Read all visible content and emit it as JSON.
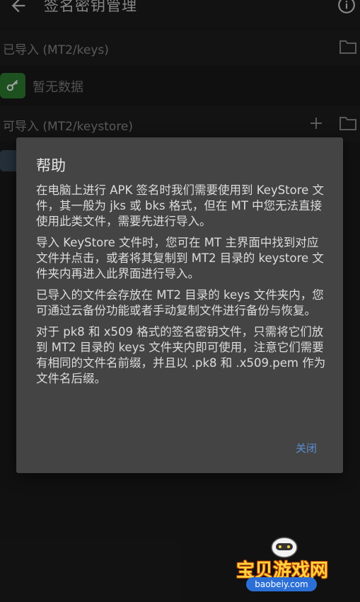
{
  "appbar": {
    "title": "签名密钥管理"
  },
  "sections": {
    "imported_label": "已导入 (MT2/keys)",
    "empty_label": "暂无数据",
    "importable_label": "可导入 (MT2/keystore)"
  },
  "dialog": {
    "title": "帮助",
    "paragraphs": [
      "在电脑上进行 APK 签名时我们需要使用到 KeyStore 文件，其一般为 jks 或 bks 格式，但在 MT 中您无法直接使用此类文件，需要先进行导入。",
      "导入 KeyStore 文件时，您可在 MT 主界面中找到对应文件并点击，或者将其复制到 MT2 目录的 keystore 文件夹内再进入此界面进行导入。",
      "已导入的文件会存放在 MT2 目录的 keys 文件夹内，您可通过云备份功能或者手动复制文件进行备份与恢复。",
      "对于 pk8 和 x509 格式的签名密钥文件，只需将它们放到 MT2 目录的 keys 文件夹内即可使用，注意它们需要有相同的文件名前缀，并且以 .pk8 和 .x509.pem 作为文件名后缀。"
    ],
    "close_label": "关闭"
  },
  "watermark": {
    "name": "宝贝游戏网",
    "url": "baobeiy.com"
  },
  "icons": {
    "back": "arrow-left-icon",
    "info": "info-icon",
    "folder": "folder-icon",
    "plus": "plus-icon",
    "key": "key-icon"
  },
  "colors": {
    "accent_link": "#5b8fd6",
    "key_badge": "#2e7d32",
    "dialog_bg": "#444444"
  }
}
